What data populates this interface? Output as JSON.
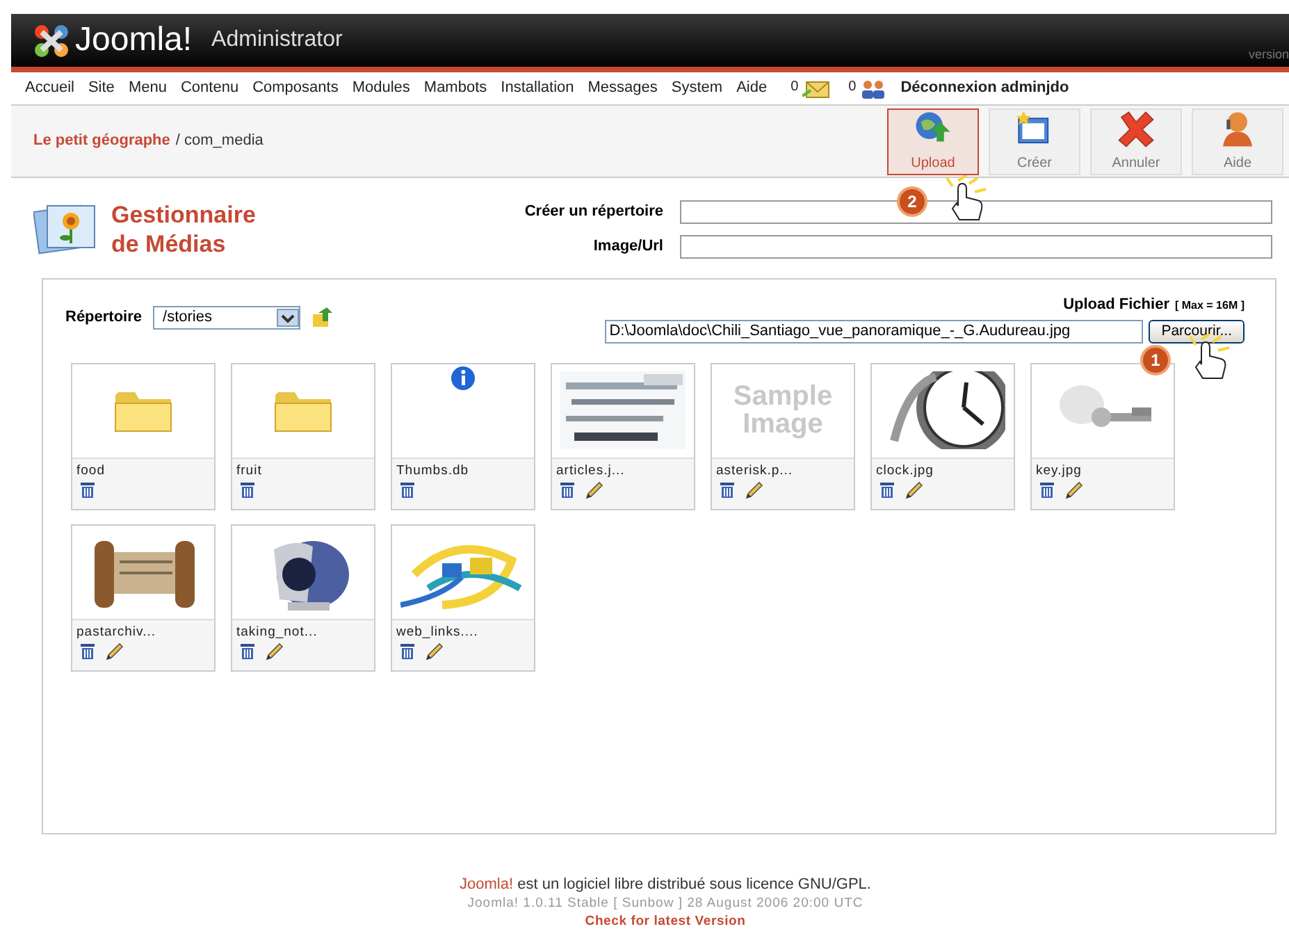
{
  "header": {
    "logo": "Joomla!",
    "title": "Administrator",
    "version": "version"
  },
  "menu": [
    "Accueil",
    "Site",
    "Menu",
    "Contenu",
    "Composants",
    "Modules",
    "Mambots",
    "Installation",
    "Messages",
    "System",
    "Aide"
  ],
  "status": {
    "messages": "0",
    "users": "0",
    "logout": "Déconnexion adminjdo"
  },
  "breadcrumb": {
    "site": "Le petit géographe",
    "path": "/ com_media"
  },
  "toolbar": [
    {
      "label": "Upload",
      "kind": "upload",
      "selected": true
    },
    {
      "label": "Créer",
      "kind": "create",
      "selected": false
    },
    {
      "label": "Annuler",
      "kind": "cancel",
      "selected": false
    },
    {
      "label": "Aide",
      "kind": "help",
      "selected": false
    }
  ],
  "page_title": "Gestionnaire de Médias",
  "fields": [
    {
      "label": "Créer un répertoire"
    },
    {
      "label": "Image/Url"
    }
  ],
  "directory": {
    "label": "Répertoire",
    "value": "/stories"
  },
  "upload": {
    "label": "Upload Fichier",
    "max": "[ Max = 16M ]",
    "value": "D:\\Joomla\\doc\\Chili_Santiago_vue_panoramique_-_G.Audureau.jpg",
    "button": "Parcourir..."
  },
  "items": [
    {
      "name": "food",
      "kind": "folder",
      "editable": false
    },
    {
      "name": "fruit",
      "kind": "folder",
      "editable": false
    },
    {
      "name": "Thumbs.db",
      "kind": "info",
      "editable": false
    },
    {
      "name": "articles.j...",
      "kind": "picture",
      "editable": true
    },
    {
      "name": "asterisk.p...",
      "kind": "sample",
      "thumb_text": "Sample Image",
      "editable": true
    },
    {
      "name": "clock.jpg",
      "kind": "picture",
      "editable": true
    },
    {
      "name": "key.jpg",
      "kind": "picture",
      "editable": true
    },
    {
      "name": "pastarchiv...",
      "kind": "picture",
      "editable": true
    },
    {
      "name": "taking_not...",
      "kind": "picture",
      "editable": true
    },
    {
      "name": "web_links....",
      "kind": "picture",
      "editable": true
    }
  ],
  "footer": {
    "brand": "Joomla!",
    "license": "est un logiciel libre distribué sous licence GNU/GPL.",
    "version": "Joomla! 1.0.11 Stable [ Sunbow ] 28 August 2006 20:00 UTC",
    "link": "Check for latest Version"
  },
  "callouts": [
    {
      "number": "2"
    },
    {
      "number": "1"
    }
  ]
}
